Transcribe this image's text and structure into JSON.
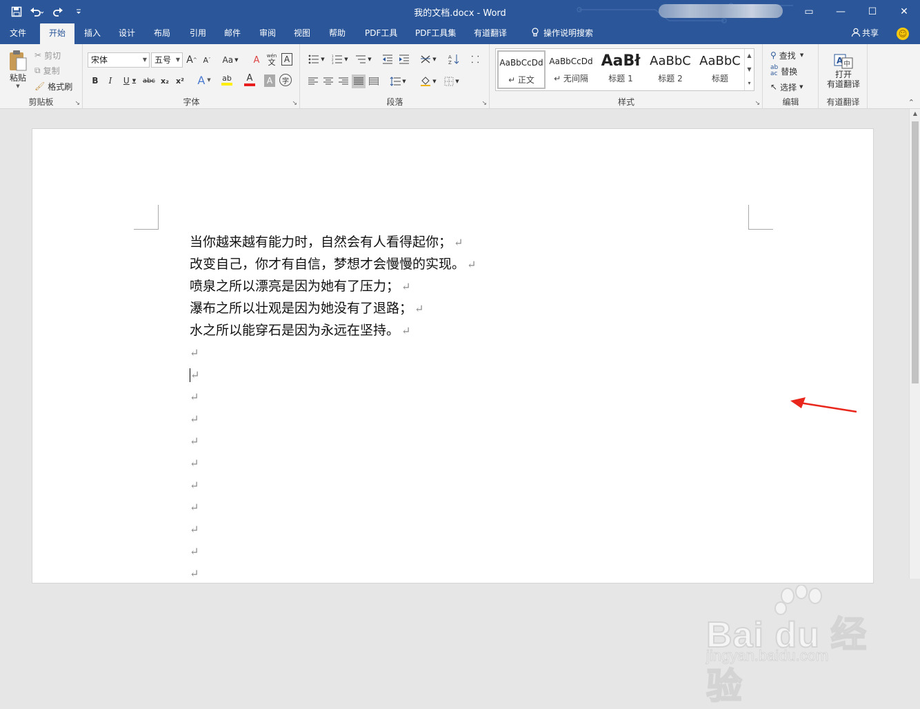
{
  "window": {
    "title": "我的文档.docx  -  Word",
    "controls": {
      "ribbon_display": "▭",
      "minimize": "—",
      "maximize": "☐",
      "close": "✕"
    }
  },
  "qat": {
    "save_icon": "save-icon",
    "undo_icon": "undo-icon",
    "redo_icon": "redo-icon",
    "customize_icon": "customize-icon"
  },
  "tabs": [
    "文件",
    "开始",
    "插入",
    "设计",
    "布局",
    "引用",
    "邮件",
    "审阅",
    "视图",
    "帮助",
    "PDF工具",
    "PDF工具集",
    "有道翻译"
  ],
  "active_tab": "开始",
  "tell_me": "操作说明搜索",
  "share": "共享",
  "clipboard": {
    "paste": "粘贴",
    "cut": "剪切",
    "copy": "复制",
    "format_painter": "格式刷",
    "label": "剪贴板"
  },
  "font": {
    "name": "宋体",
    "size": "五号",
    "label": "字体",
    "wen": "wén",
    "wen_char": "文",
    "aa": "Aa",
    "circle_char": "字",
    "grow": "A",
    "shrink": "A",
    "bold": "B",
    "italic": "I",
    "underline": "U",
    "strike": "abc",
    "sub": "x₂",
    "sup": "x²",
    "text_effect": "A",
    "highlight": "ab",
    "font_color": "A",
    "shade_char": "A",
    "clear_format": "A"
  },
  "paragraph": {
    "label": "段落"
  },
  "styles": {
    "label": "样式",
    "items": [
      {
        "sample": "AaBbCcDd",
        "name": "↵ 正文"
      },
      {
        "sample": "AaBbCcDd",
        "name": "↵ 无间隔"
      },
      {
        "sample": "AaBł",
        "name": "标题 1"
      },
      {
        "sample": "AaBbC",
        "name": "标题 2"
      },
      {
        "sample": "AaBbC",
        "name": "标题"
      }
    ]
  },
  "editing": {
    "find": "查找",
    "replace": "替换",
    "select": "选择",
    "label": "编辑"
  },
  "youdao": {
    "open": "打开",
    "open2": "有道翻译",
    "label": "有道翻译"
  },
  "document": {
    "lines": [
      "当你越来越有能力时，自然会有人看得起你；",
      "改变自己，你才有自信，梦想才会慢慢的实现。",
      "喷泉之所以漂亮是因为她有了压力；",
      "瀑布之所以壮观是因为她没有了退路；",
      "水之所以能穿石是因为永远在坚持。"
    ],
    "paragraph_mark": "↵",
    "empty_lines": 11
  },
  "watermark": {
    "main": "Bai du 经验",
    "sub": "jingyan.baidu.com"
  },
  "colors": {
    "accent": "#2b579a",
    "arrow": "#e8261b"
  }
}
